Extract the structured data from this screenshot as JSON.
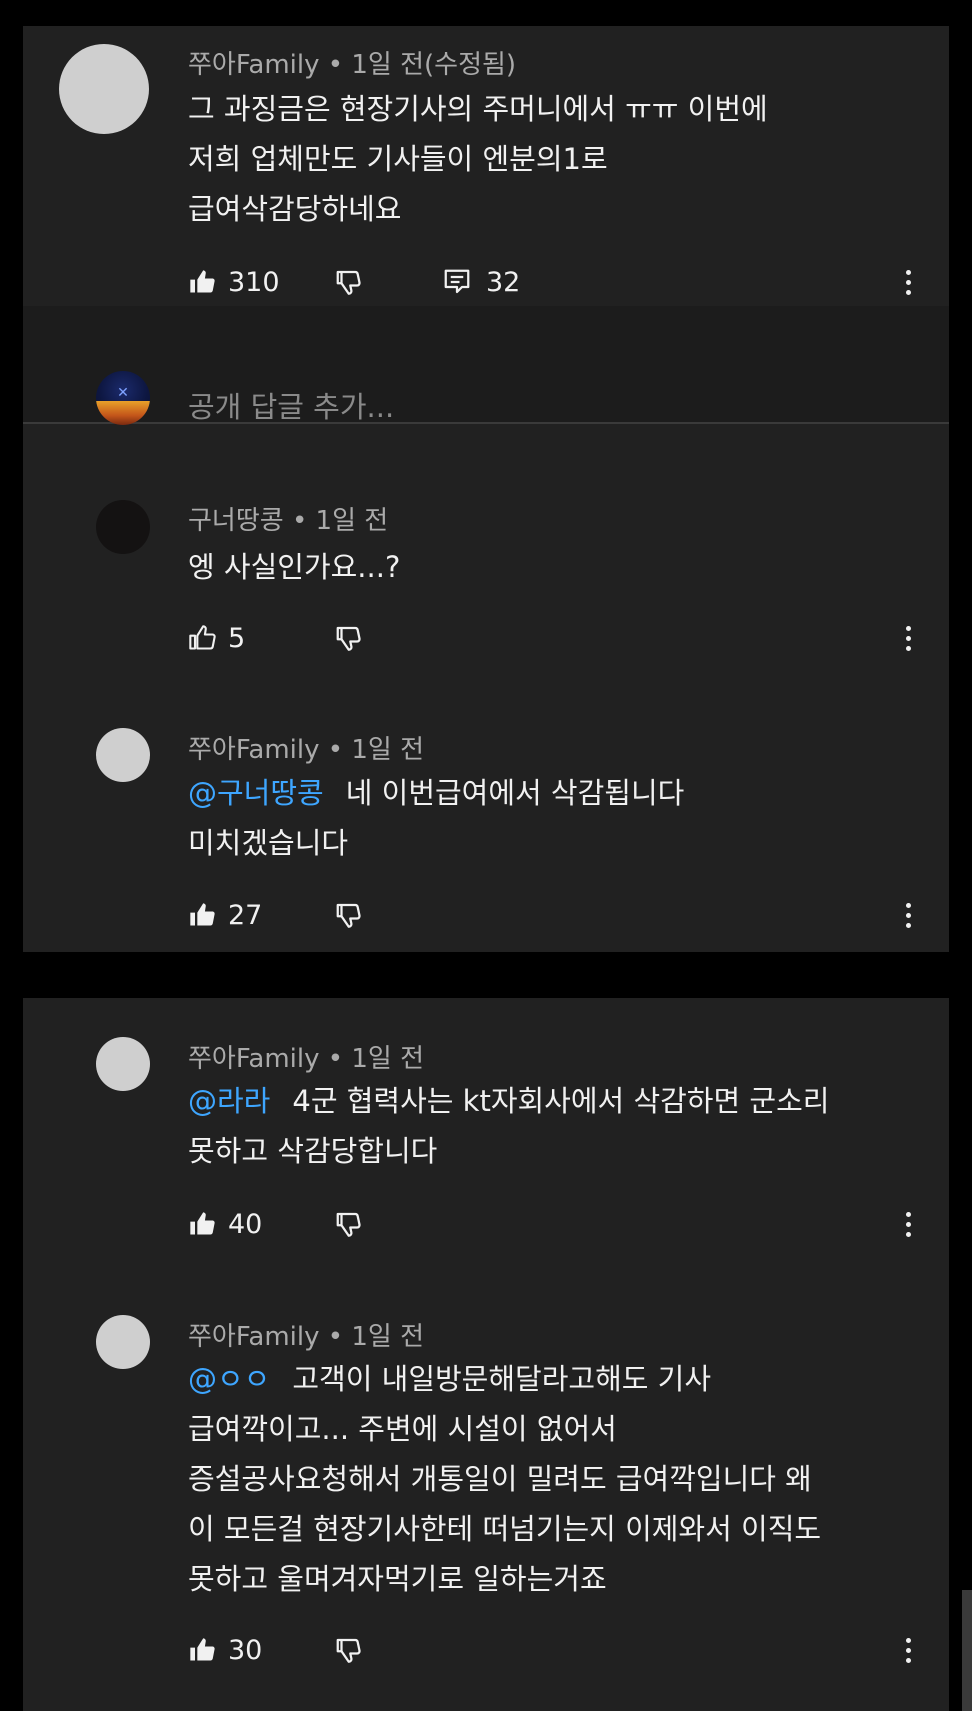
{
  "comment1": {
    "author_line": "쭈아Family • 1일 전(수정됨)",
    "lines": [
      "그 과징금은 현장기사의 주머니에서 ㅠㅠ 이번에",
      "저희 업체만도 기사들이 엔분의1로",
      "급여삭감당하네요"
    ],
    "likes": "310",
    "replies": "32"
  },
  "reply_box": {
    "placeholder": "공개 답글 추가..."
  },
  "replies": [
    {
      "author_line": "구너땅콩 • 1일 전",
      "mention": "",
      "lines": [
        "엥 사실인가요...?"
      ],
      "likes": "5"
    },
    {
      "author_line": "쭈아Family • 1일 전",
      "mention": "@구너땅콩",
      "lines": [
        "네 이번급여에서 삭감됩니다",
        "미치겠습니다"
      ],
      "likes": "27"
    },
    {
      "author_line": "쭈아Family • 1일 전",
      "mention": "@라라",
      "lines": [
        "4군 협력사는 kt자회사에서 삭감하면 군소리",
        "못하고 삭감당합니다"
      ],
      "likes": "40"
    },
    {
      "author_line": "쭈아Family • 1일 전",
      "mention": "@ㅇㅇ",
      "lines": [
        "고객이 내일방문해달라고해도 기사",
        "급여깍이고... 주변에 시설이 없어서",
        "증설공사요청해서 개통일이 밀려도 급여깍입니다 왜",
        "이 모든걸 현장기사한테 떠넘기는지 이제와서 이직도",
        "못하고 울며겨자먹기로 일하는거죠"
      ],
      "likes": "30"
    }
  ],
  "icons": {
    "like_filled": "thumbs-up-filled-icon",
    "like_outline": "thumbs-up-outline-icon",
    "dislike": "thumbs-down-icon",
    "reply": "reply-comment-icon",
    "more": "more-vertical-icon"
  },
  "colors": {
    "background": "#212121",
    "mention": "#3ea6ff",
    "meta": "#aaaaaa",
    "text": "#f1f1f1"
  }
}
